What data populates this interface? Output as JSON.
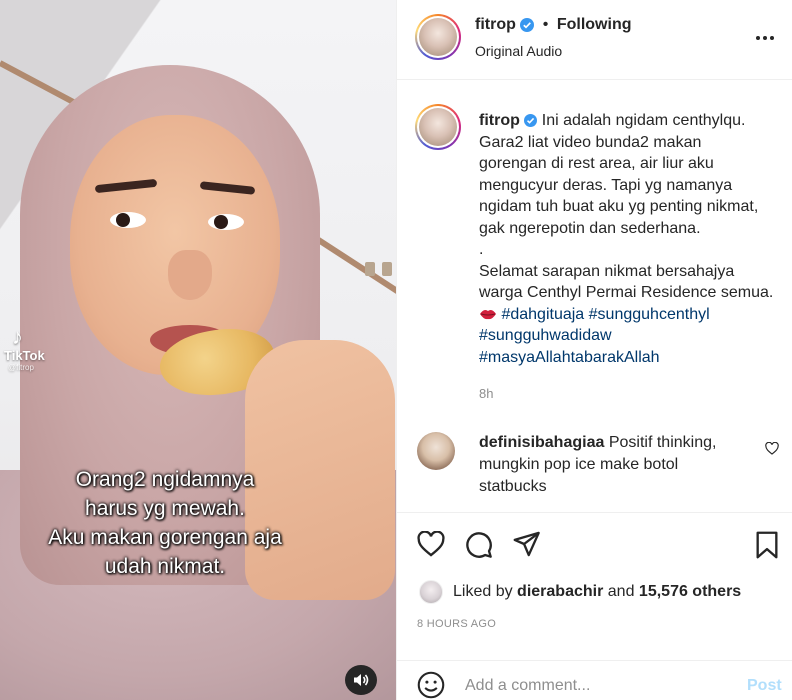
{
  "post": {
    "username": "fitrop",
    "follow_label": "Following",
    "audio": "Original Audio",
    "more_icon": "more-horizontal-icon"
  },
  "video": {
    "watermark_brand": "TikTok",
    "watermark_handle": "@fitrop",
    "overlay_lines": [
      "Orang2 ngidamnya",
      "harus yg mewah.",
      "Aku makan gorengan aja",
      "udah nikmat."
    ],
    "sound_icon": "volume-icon"
  },
  "caption": {
    "username": "fitrop",
    "lines": [
      "Ini adalah ngidam centhylqu.",
      "Gara2 liat video bunda2 makan",
      "gorengan di rest area, air liur aku",
      "mengucyur deras. Tapi yg namanya",
      "ngidam tuh buat aku yg penting nikmat,",
      "gak ngerepotin dan sederhana.",
      ".",
      "Selamat sarapan nikmat bersahajya",
      "warga Centhyl Permai Residence semua."
    ],
    "hashtags_line1": [
      "#dahgituaja",
      "#sungguhcenthyl"
    ],
    "hashtag_line2": "#sungguhwadidaw",
    "hashtag_line3": "#masyaAllahtabarakAllah",
    "age": "8h"
  },
  "comment": {
    "username": "definisibahagiaa",
    "lines": [
      "Positif thinking,",
      "mungkin pop ice make botol",
      "statbucks"
    ]
  },
  "likes": {
    "prefix": "Liked by",
    "user": "dierabachir",
    "middle": "and",
    "others": "15,576 others"
  },
  "time_ago": "8 HOURS AGO",
  "composer": {
    "placeholder": "Add a comment...",
    "post_label": "Post"
  },
  "colors": {
    "link": "#00376b",
    "verified": "#3897f0",
    "muted": "#8e8e8e",
    "post_disabled": "#b2dffc"
  }
}
